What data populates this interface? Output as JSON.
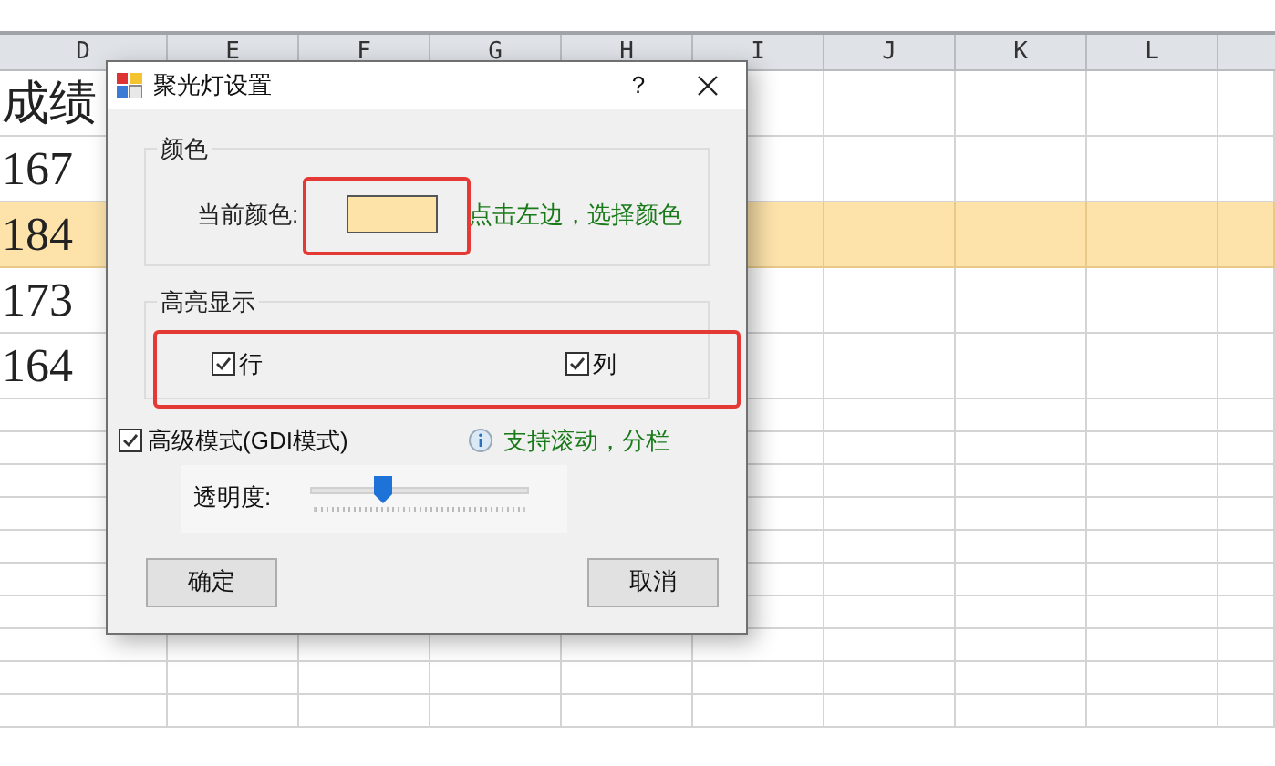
{
  "sheet": {
    "columns": [
      "D",
      "E",
      "F",
      "G",
      "H",
      "I",
      "J",
      "K",
      "L"
    ],
    "rows": [
      {
        "cell": "成绩",
        "highlighted": false
      },
      {
        "cell": "167",
        "highlighted": false
      },
      {
        "cell": "184",
        "highlighted": true
      },
      {
        "cell": "173",
        "highlighted": false
      },
      {
        "cell": "164",
        "highlighted": false
      }
    ]
  },
  "dialog": {
    "title": "聚光灯设置",
    "help": "?",
    "color_group": {
      "title": "颜色",
      "label": "当前颜色:",
      "color": "#fde3a7",
      "hint": "点击左边，选择颜色"
    },
    "highlight_group": {
      "title": "高亮显示",
      "options": [
        {
          "label": "行",
          "checked": true
        },
        {
          "label": "列",
          "checked": true
        }
      ]
    },
    "advanced": {
      "label": "高级模式(GDI模式)",
      "checked": true,
      "note": "支持滚动，分栏"
    },
    "opacity": {
      "label": "透明度:",
      "level": 0.32
    },
    "buttons": [
      "确定",
      "取消"
    ]
  }
}
